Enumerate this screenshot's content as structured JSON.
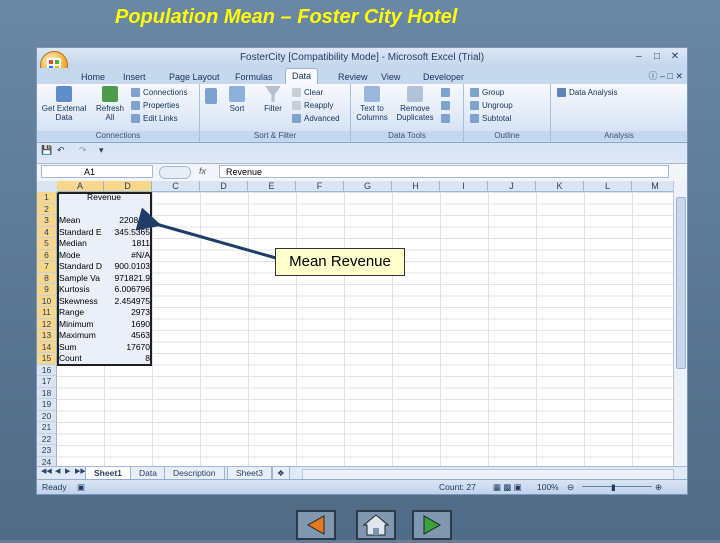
{
  "slide": {
    "title": "Population Mean – Foster City Hotel",
    "callout": "Mean Revenue",
    "nav": [
      "back-button",
      "home-button",
      "forward-button"
    ]
  },
  "excel": {
    "window_title": "FosterCity  [Compatibility Mode] - Microsoft Excel (Trial)",
    "tabs": [
      "Home",
      "Insert",
      "Page Layout",
      "Formulas",
      "Data",
      "Review",
      "View",
      "Developer"
    ],
    "active_tab": "Data",
    "ribbon": {
      "connections": {
        "get_external": "Get External Data",
        "refresh": "Refresh All",
        "connections": "Connections",
        "properties": "Properties",
        "edit_links": "Edit Links",
        "label": "Connections"
      },
      "sort_filter": {
        "sort": "Sort",
        "filter": "Filter",
        "clear": "Clear",
        "reapply": "Reapply",
        "advanced": "Advanced",
        "label": "Sort & Filter"
      },
      "data_tools": {
        "text_to_columns": "Text to Columns",
        "remove_duplicates": "Remove Duplicates",
        "label": "Data Tools"
      },
      "outline": {
        "group": "Group",
        "ungroup": "Ungroup",
        "subtotal": "Subtotal",
        "label": "Outline"
      },
      "analysis": {
        "data_analysis": "Data Analysis",
        "label": "Analysis"
      }
    },
    "name_box": "A1",
    "fx": "fx",
    "formula": "Revenue",
    "columns": [
      "A",
      "D",
      "C",
      "D",
      "E",
      "F",
      "G",
      "H",
      "I",
      "J",
      "K",
      "L",
      "M"
    ],
    "rows": [
      "1",
      "2",
      "3",
      "4",
      "5",
      "6",
      "7",
      "8",
      "9",
      "10",
      "11",
      "12",
      "13",
      "14",
      "15",
      "16",
      "17",
      "18",
      "19",
      "20",
      "21",
      "22",
      "23",
      "24"
    ],
    "cells": [
      [
        "Revenue",
        ""
      ],
      [
        "",
        ""
      ],
      [
        "Mean",
        "2208.75"
      ],
      [
        "Standard E",
        "345.5365"
      ],
      [
        "Median",
        "1811"
      ],
      [
        "Mode",
        "#N/A"
      ],
      [
        "Standard D",
        "900.0103"
      ],
      [
        "Sample Va",
        "971821.9"
      ],
      [
        "Kurtosis",
        "6.006796"
      ],
      [
        "Skewness",
        "2.454975"
      ],
      [
        "Range",
        "2973"
      ],
      [
        "Minimum",
        "1690"
      ],
      [
        "Maximum",
        "4563"
      ],
      [
        "Sum",
        "17670"
      ],
      [
        "Count",
        "8"
      ]
    ],
    "sheets": [
      "Sheet1",
      "Data",
      "Description",
      "Sheet3"
    ],
    "active_sheet": "Sheet1",
    "status": {
      "ready": "Ready",
      "count": "Count: 27",
      "zoom": "100%"
    }
  }
}
